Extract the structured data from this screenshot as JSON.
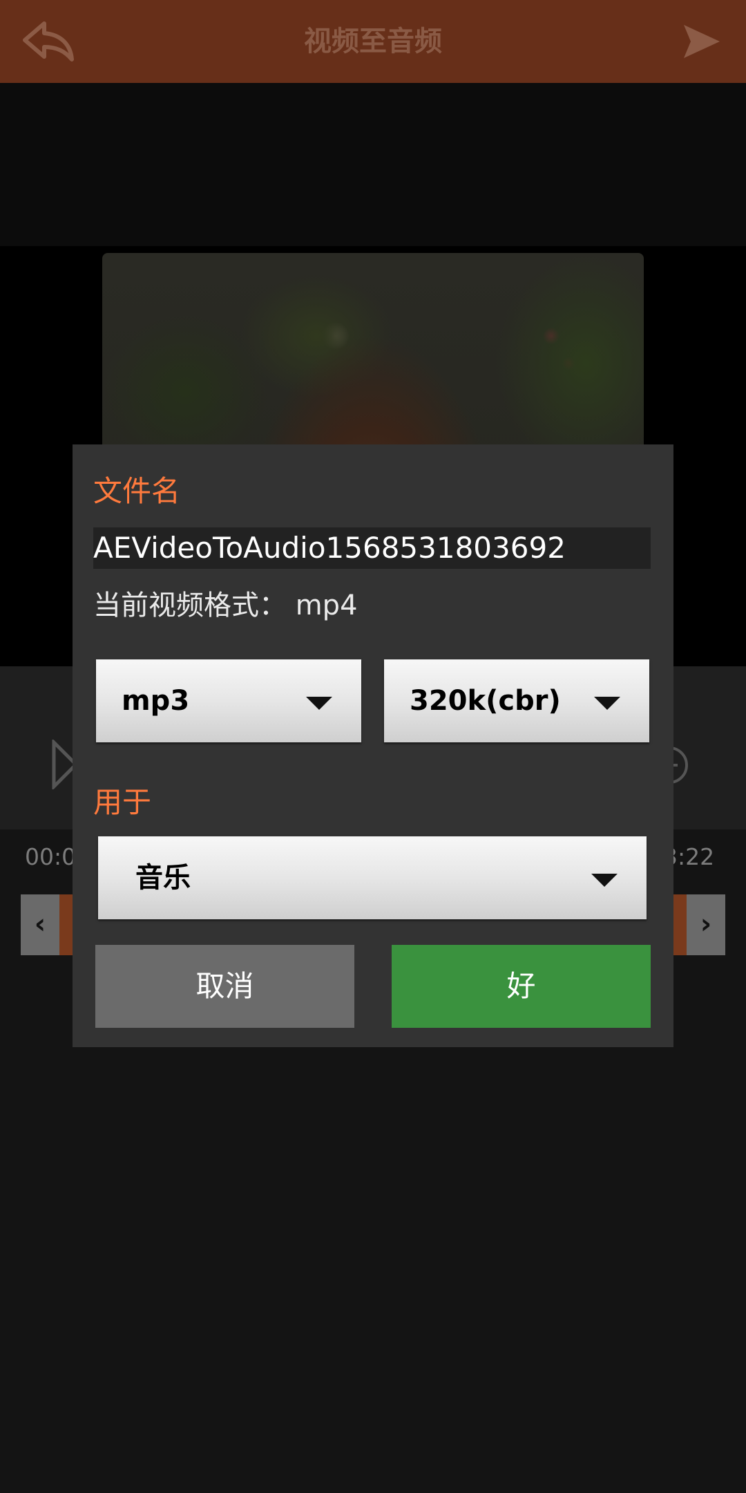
{
  "appbar": {
    "title": "视频至音频",
    "back_icon": "back-arrow-icon",
    "send_icon": "send-icon"
  },
  "player": {
    "time_start": "00:0",
    "time_end": "3:22",
    "prev_label": "‹",
    "next_label": "›"
  },
  "dialog": {
    "filename_label": "文件名",
    "filename_value": "AEVideoToAudio1568531803692",
    "current_format": "当前视频格式： mp4",
    "format_selected": "mp3",
    "bitrate_selected": "320k(cbr)",
    "usage_label": "用于",
    "usage_selected": "音乐",
    "cancel_label": "取消",
    "ok_label": "好"
  },
  "colors": {
    "appbar": "#672f19",
    "accent": "#ff7a3d",
    "ok_button": "#3a923e",
    "cancel_button": "#6b6b6b"
  }
}
